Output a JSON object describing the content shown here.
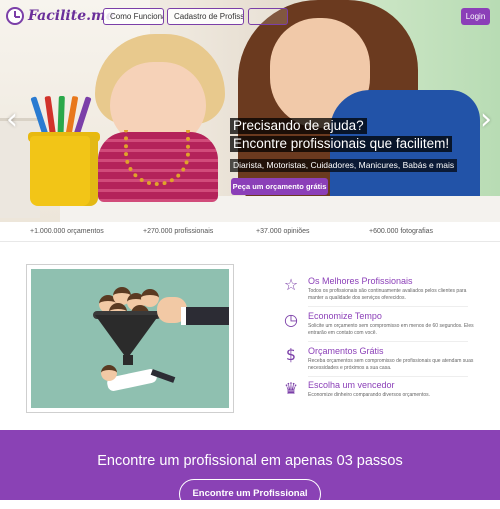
{
  "header": {
    "logo_text": "Facilite.me",
    "nav": [
      {
        "label": "Como Funciona?"
      },
      {
        "label": "Cadastro de Profissional"
      },
      {
        "label": ""
      }
    ],
    "login_label": "Login"
  },
  "hero": {
    "line1": "Precisando de ajuda?",
    "line2": "Encontre profissionais que facilitem!",
    "line3": "Diarista, Motoristas, Cuidadores, Manicures, Babás e mais",
    "cta": "Peça um orçamento grátis",
    "prev_arrow": "‹",
    "next_arrow": "›"
  },
  "stats": [
    "+1.000.000 orçamentos",
    "+270.000 profissionais",
    "+37.000 opiniões",
    "+600.000 fotografias"
  ],
  "features": [
    {
      "icon": "star-icon",
      "glyph": "☆",
      "title": "Os Melhores Profissionais",
      "desc": "Todos os profissionais são continuamente avaliados pelos clientes para manter a qualidade dos serviços oferecidos."
    },
    {
      "icon": "clock-icon",
      "glyph": "◷",
      "title": "Economize Tempo",
      "desc": "Solicite um orçamento sem compromisso em menos de 60 segundos. Eles entrarão em contato com você."
    },
    {
      "icon": "dollar-icon",
      "glyph": "$",
      "title": "Orçamentos Grátis",
      "desc": "Receba orçamentos sem compromisso de profissionais que atendam suas necessidades e próximos a sua casa."
    },
    {
      "icon": "trophy-icon",
      "glyph": "♛",
      "title": "Escolha um vencedor",
      "desc": "Economize dinheiro comparando diversos orçamentos."
    }
  ],
  "band": {
    "title": "Encontre um profissional em apenas 03 passos",
    "button": "Encontre um Profissional"
  },
  "colors": {
    "accent": "#8b3fb8",
    "band": "#8a42b5"
  }
}
